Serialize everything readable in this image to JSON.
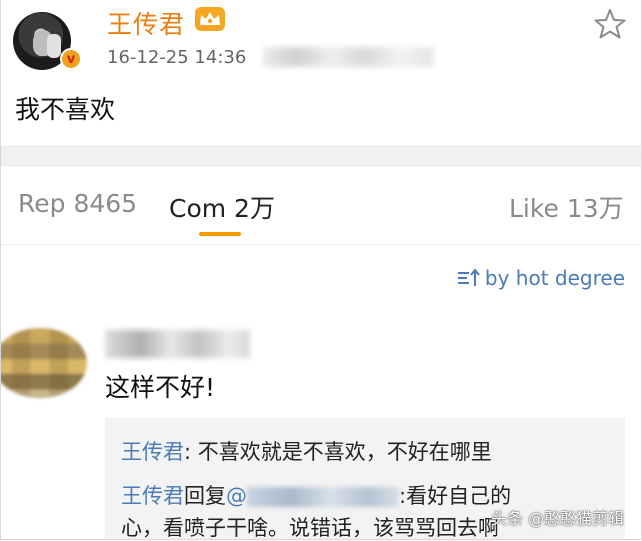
{
  "post": {
    "username": "王传君",
    "timestamp": "16-12-25 14:36",
    "text": "我不喜欢"
  },
  "tabs": {
    "rep": "Rep 8465",
    "com": "Com 2万",
    "like": "Like 13万",
    "active": "com"
  },
  "sort": {
    "label": "by hot degree"
  },
  "comment": {
    "text": "这样不好!",
    "replies": [
      {
        "name": "王传君",
        "sep": ": ",
        "text": "不喜欢就是不喜欢，不好在哪里"
      },
      {
        "name": "王传君",
        "reply_word": "回复",
        "mention_prefix": "@",
        "text_after": ":看好自己的",
        "continuation": "心，看喷子干啥。说错话，该骂骂回去啊"
      }
    ]
  },
  "watermark": "头条 @憨憨猫剪辑",
  "colors": {
    "username": "#eb7e10",
    "link_blue": "#4a7bb8",
    "tab_active_underline": "#f59b00",
    "section_gap": "#f1f1f1"
  }
}
